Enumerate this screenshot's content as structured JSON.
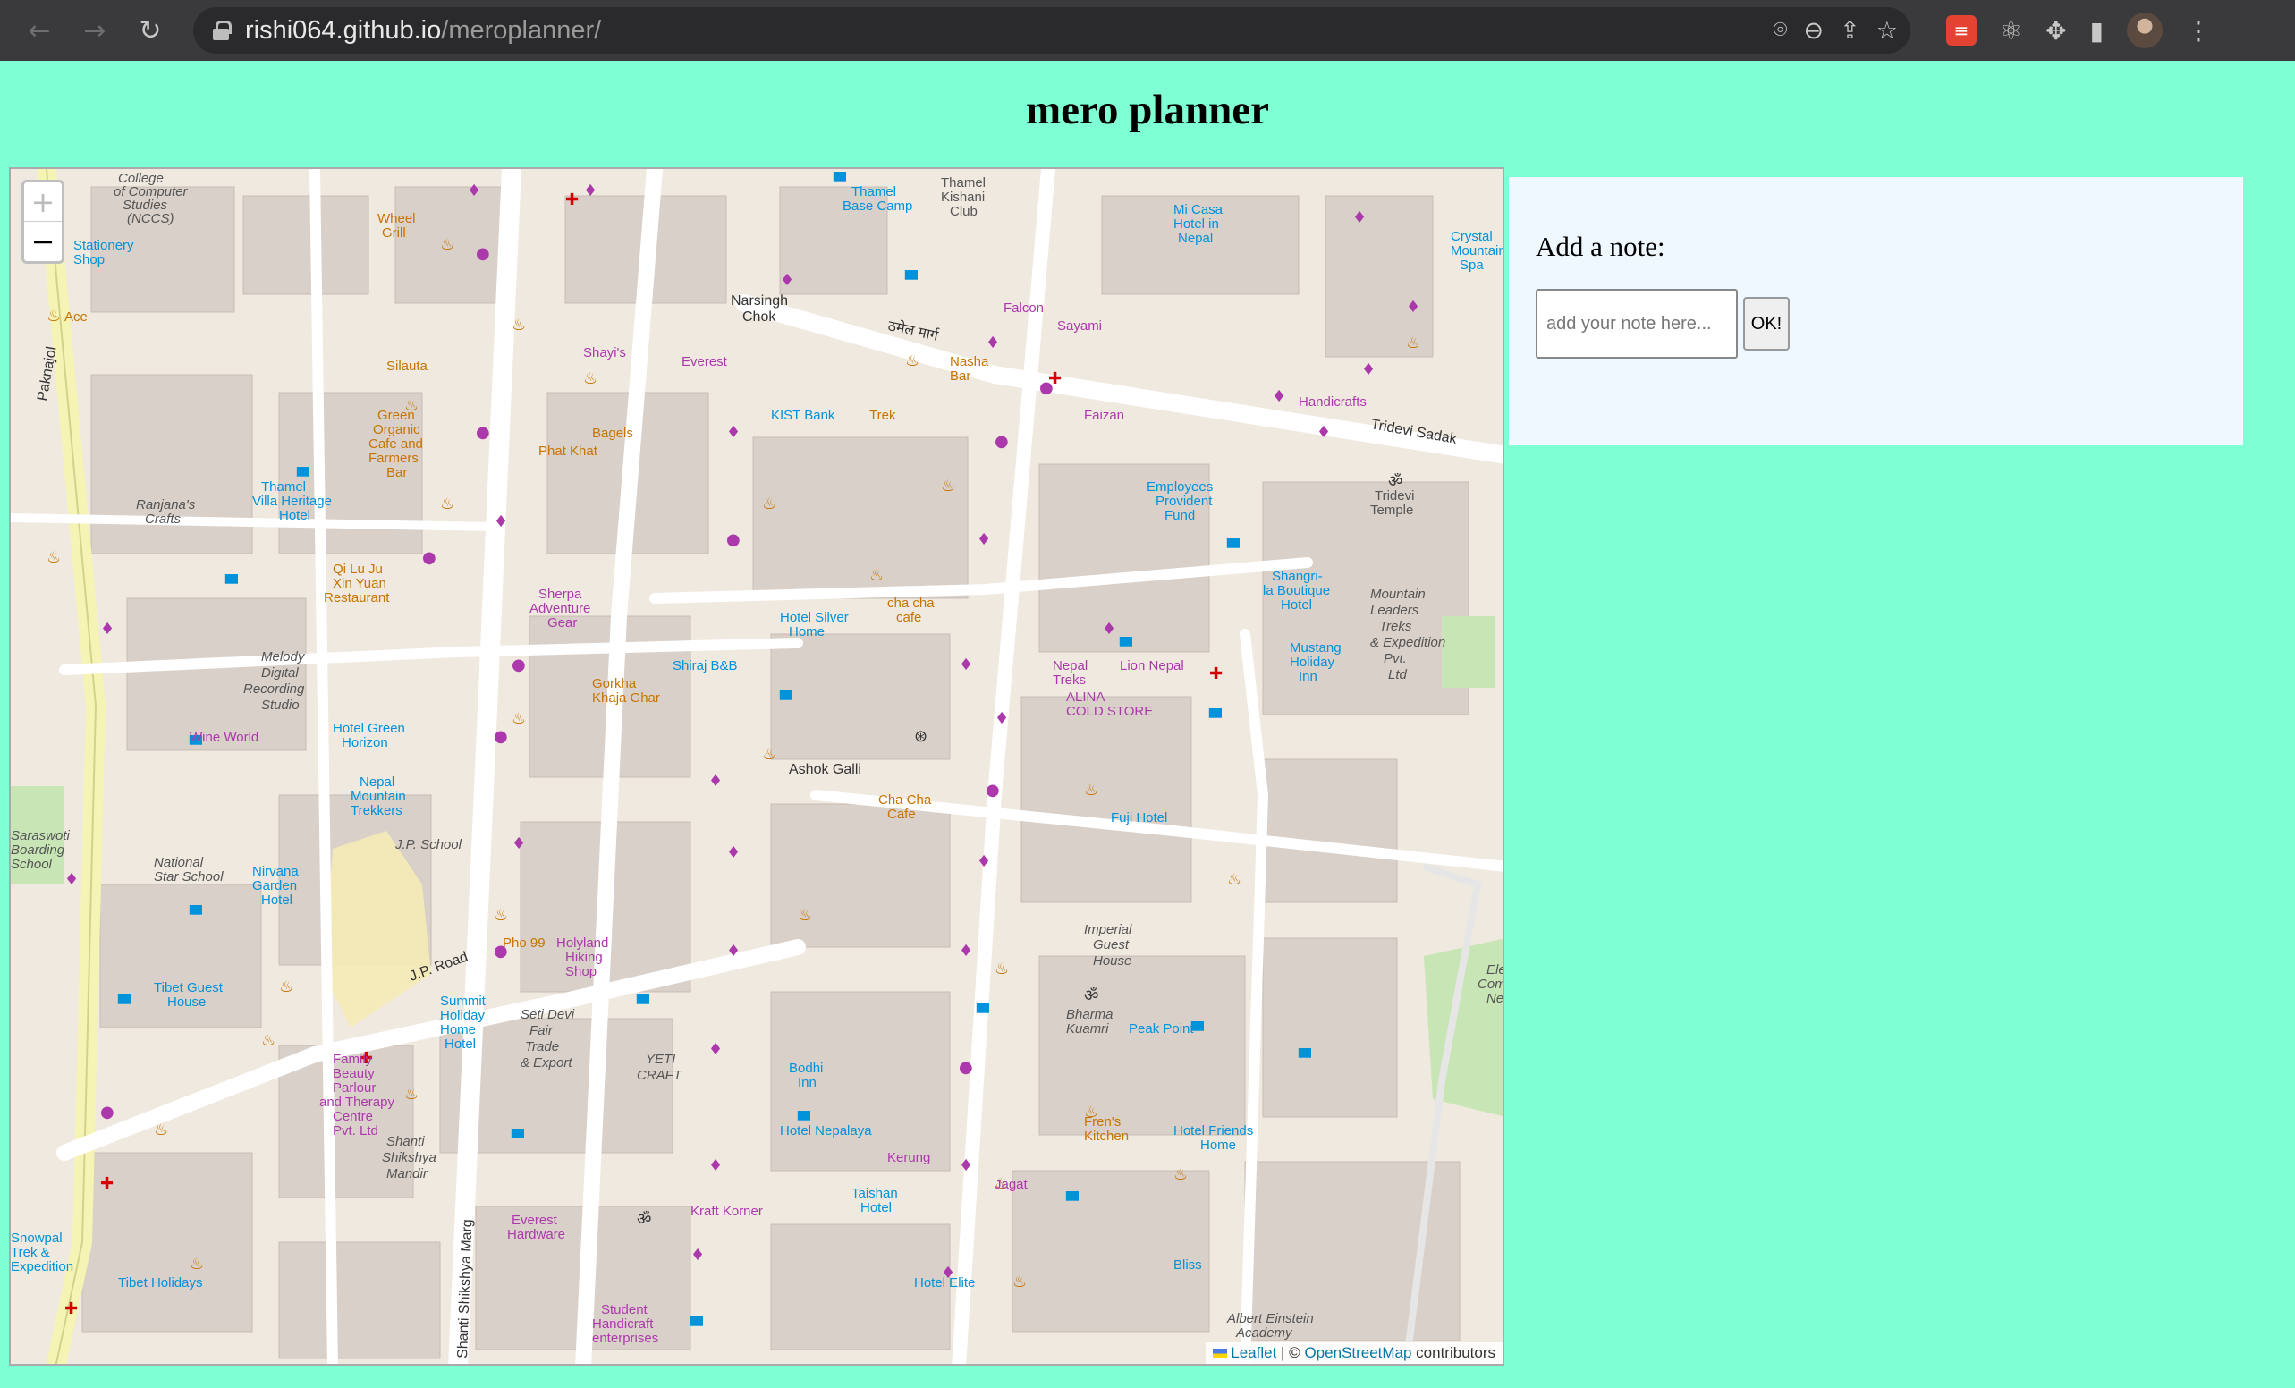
{
  "browser": {
    "url_host": "rishi064.github.io",
    "url_path": "/meroplanner/"
  },
  "page": {
    "title": "mero planner"
  },
  "map": {
    "zoom_in_label": "+",
    "zoom_out_label": "−",
    "attribution": {
      "leaflet": "Leaflet",
      "separator": " | © ",
      "osm": "OpenStreetMap",
      "suffix": " contributors"
    },
    "street_labels": [
      "Paknajol",
      "J.P. Road",
      "Ashok Galli",
      "Tridevi Sadak",
      "Narsingh Chok",
      "ठमेल मार्ग",
      "Shanti Shikshya Marg"
    ],
    "place_labels": [
      "College of Computer Studies (NCCS)",
      "Stationery Shop",
      "Wheel Grill",
      "Thamel Base Camp",
      "Thamel Kishani Club",
      "Mi Casa Hotel in Nepal",
      "Crystal Mountain Spa",
      "Ace",
      "Shayi's",
      "Everest",
      "Nasha Bar",
      "Falcon",
      "Sayami",
      "Handicrafts",
      "Faizan",
      "Silauta",
      "Green Organic Cafe and Farmers Bar",
      "Phat Khat",
      "Bagels",
      "Trek",
      "KIST Bank",
      "Employees Provident Fund",
      "Tridevi Temple",
      "Thamel Villa Heritage Hotel",
      "Ranjana's Crafts",
      "Qi Lu Ju Xin Yuan Restaurant",
      "Sherpa Adventure Gear",
      "Hotel Silver Home",
      "cha cha cafe",
      "Shangri-la Boutique Hotel",
      "Mountain Leaders Treks & Expedition Pvt. Ltd",
      "Melody Digital Recording Studio",
      "Shiraj B&B",
      "Gorkha Khaja Ghar",
      "Nepal Treks",
      "Lion Nepal",
      "ALINA COLD STORE",
      "Mustang Holiday Inn",
      "Wine World",
      "Hotel Green Horizon",
      "Nepal Mountain Trekkers",
      "Cha Cha Cafe",
      "J.P. School",
      "Fuji Hotel",
      "Saraswoti Boarding School",
      "National Star School",
      "Nirvana Garden Hotel",
      "Pho 99",
      "Holyland Hiking Shop",
      "Imperial Guest House",
      "Election Commission Nepal",
      "Tibet Guest House",
      "Summit Holiday Home Hotel",
      "Seti Devi Fair Trade & Export",
      "Bharma Kuamri",
      "Peak Point",
      "YETI CRAFT",
      "Family Beauty Parlour and Therapy Centre Pvt. Ltd",
      "Bodhi Inn",
      "Hotel Nepalaya",
      "Fren's Kitchen",
      "Hotel Friends Home",
      "Shanti Shikshya Mandir",
      "Kerung",
      "Jagat",
      "Taishan Hotel",
      "Everest Hardware",
      "Kraft Korner",
      "Bliss",
      "Hotel Elite",
      "Tibet Holidays",
      "Student Handicraft enterprises",
      "Albert Einstein Academy",
      "Snowpal Trek & Expedition"
    ]
  },
  "note_panel": {
    "label": "Add a note:",
    "input_placeholder": "add your note here...",
    "ok_label": "OK!"
  },
  "colors": {
    "page_background": "#7fffd4",
    "panel_background": "#f0f8ff",
    "map_land": "#efe9df",
    "map_road": "#ffffff",
    "map_main_road": "#f7fabf",
    "poi_shop": "#ac39ac",
    "poi_food": "#c77400",
    "poi_hotel": "#0092da"
  }
}
